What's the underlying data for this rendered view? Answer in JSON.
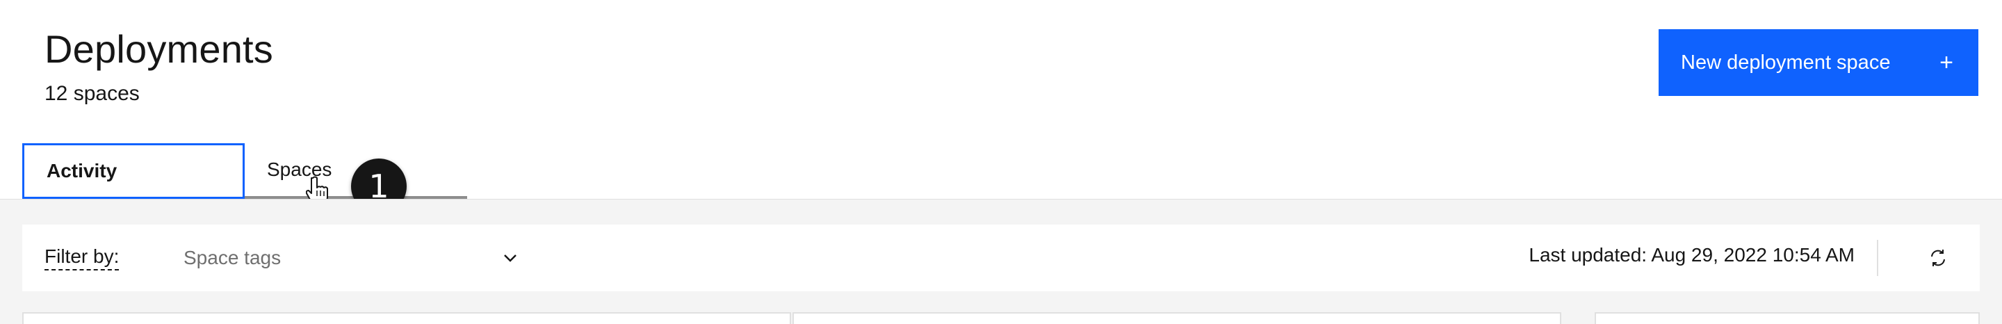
{
  "header": {
    "title": "Deployments",
    "subtitle": "12 spaces",
    "primary_button": {
      "label": "New deployment space",
      "icon": "plus-icon",
      "icon_glyph": "+",
      "color": "#0f62fe"
    }
  },
  "tabs": [
    {
      "label": "Activity",
      "active": true
    },
    {
      "label": "Spaces",
      "active": false
    }
  ],
  "tour_badge": "1",
  "toolbar": {
    "filter_label": "Filter by:",
    "filter_placeholder": "Space tags",
    "last_updated": "Last updated: Aug 29, 2022 10:54 AM",
    "refresh_icon": "refresh-icon",
    "chevron_icon": "chevron-down-icon"
  },
  "colors": {
    "accent": "#0f62fe",
    "background": "#f4f4f4",
    "text": "#161616",
    "placeholder": "#6f6f6f"
  }
}
